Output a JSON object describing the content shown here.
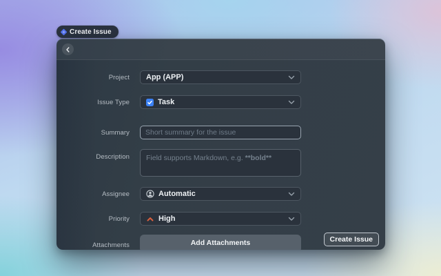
{
  "launcher": {
    "label": "Create Issue",
    "icon": "diamond"
  },
  "dialog": {
    "header": {
      "back_icon": "chevron-left"
    },
    "fields": {
      "project": {
        "label": "Project",
        "value": "App (APP)"
      },
      "issue_type": {
        "label": "Issue Type",
        "value": "Task",
        "icon": "task-check-square"
      },
      "summary": {
        "label": "Summary",
        "value": "",
        "placeholder": "Short summary for the issue"
      },
      "description": {
        "label": "Description",
        "value": "",
        "placeholder_text": "Field supports Markdown, e.g. ",
        "placeholder_bold": "**bold**"
      },
      "assignee": {
        "label": "Assignee",
        "value": "Automatic",
        "icon": "user-circle"
      },
      "priority": {
        "label": "Priority",
        "value": "High",
        "icon": "priority-high-chevron-up"
      },
      "attachments": {
        "label": "Attachments",
        "add_button_label": "Add Attachments"
      }
    },
    "submit_button_label": "Create Issue"
  },
  "colors": {
    "accent-blue": "#3c82f6",
    "priority-high": "#d95f3d",
    "launcher-diamond": "#5272f0"
  }
}
